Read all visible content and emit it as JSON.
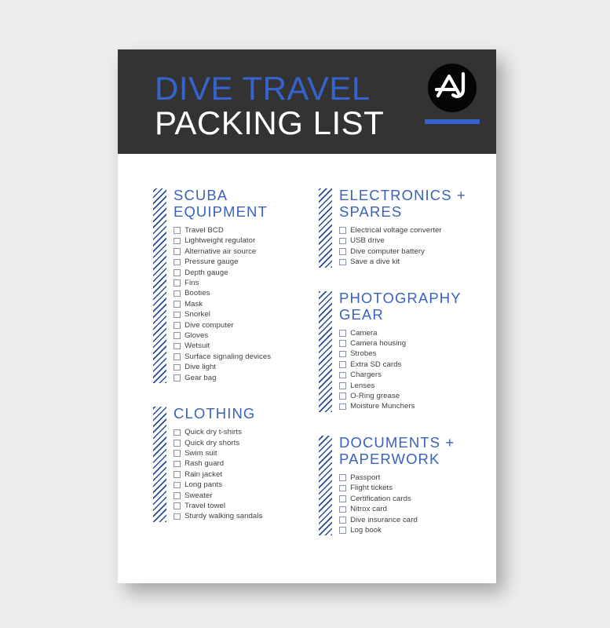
{
  "document": {
    "header": {
      "title_line1": "DIVE TRAVEL",
      "title_line2": "PACKING LIST",
      "title_line1_color": "#3663CE",
      "title_line2_color": "#FFFFFF",
      "band_color": "#333333",
      "logo": {
        "name": "aj-monogram-logo",
        "circle_color": "#050505",
        "mark_color": "#FFFFFF",
        "accent_bar_color": "#3663CE"
      }
    },
    "accent_color": "#3A62BE",
    "hatch_color": "#2B4A9B",
    "sections": [
      {
        "id": "scuba-equipment",
        "column": "left",
        "title": "SCUBA\nEQUIPMENT",
        "items": [
          "Travel BCD",
          "Lightweight regulator",
          "Alternative air source",
          "Pressure gauge",
          "Depth gauge",
          "Fins",
          "Booties",
          "Mask",
          "Snorkel",
          "Dive computer",
          "Gloves",
          "Wetsuit",
          "Surface signaling devices",
          "Dive light",
          "Gear bag"
        ]
      },
      {
        "id": "clothing",
        "column": "left",
        "title": "CLOTHING",
        "items": [
          "Quick dry t-shirts",
          "Quick dry shorts",
          "Swim suit",
          "Rash guard",
          "Rain jacket",
          "Long pants",
          "Sweater",
          "Travel towel",
          "Sturdy walking sandals"
        ]
      },
      {
        "id": "electronics-spares",
        "column": "right",
        "title": "ELECTRONICS +\nSPARES",
        "items": [
          "Electrical voltage converter",
          "USB drive",
          "Dive computer battery",
          "Save a dive kit"
        ]
      },
      {
        "id": "photography-gear",
        "column": "right",
        "title": "PHOTOGRAPHY\nGEAR",
        "items": [
          "Camera",
          "Camera housing",
          "Strobes",
          "Extra SD cards",
          "Chargers",
          "Lenses",
          "O-Ring grease",
          "Moisture Munchers"
        ]
      },
      {
        "id": "documents-paperwork",
        "column": "right",
        "title": "DOCUMENTS +\nPAPERWORK",
        "items": [
          "Passport",
          "Flight tickets",
          "Certification cards",
          "Nitrox card",
          "Dive insurance card",
          "Log book"
        ]
      }
    ]
  }
}
